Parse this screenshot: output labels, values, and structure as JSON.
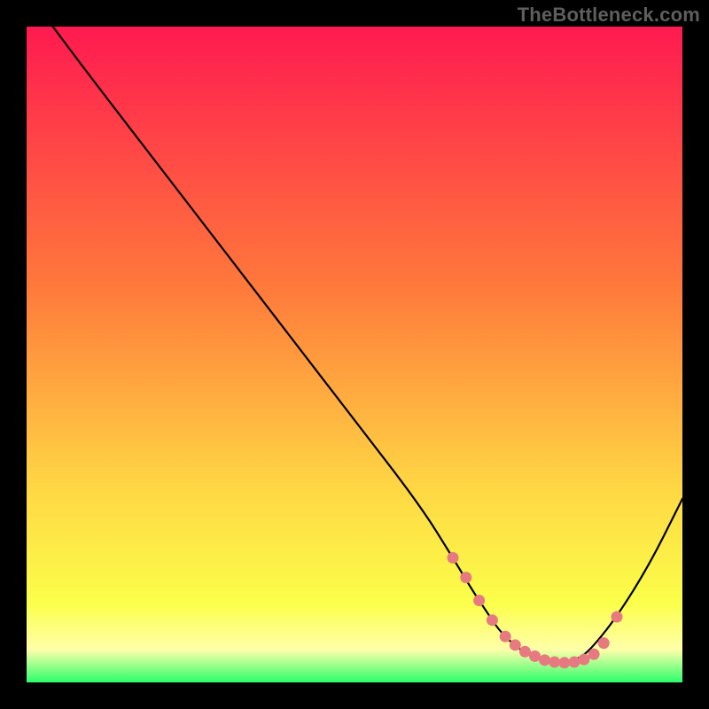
{
  "watermark": "TheBottleneck.com",
  "colors": {
    "page_bg": "#000000",
    "watermark": "#5e5e5e",
    "gradient_top": "#ff1a50",
    "gradient_mid1": "#ff7a3b",
    "gradient_mid2": "#ffd644",
    "gradient_bottom1": "#fbff4a",
    "gradient_bottom2": "#ffffaa",
    "gradient_bottom3": "#2bff6b",
    "curve": "#000000",
    "marker": "#e77a80"
  },
  "chart_data": {
    "type": "line",
    "title": "",
    "xlabel": "",
    "ylabel": "",
    "xlim": [
      0,
      100
    ],
    "ylim": [
      0,
      100
    ],
    "grid": false,
    "legend": false,
    "series": [
      {
        "name": "bottleneck-curve",
        "x": [
          4,
          10,
          20,
          30,
          40,
          50,
          60,
          65,
          68,
          70,
          72,
          74,
          76,
          78,
          80,
          82,
          84,
          86,
          90,
          95,
          100
        ],
        "y": [
          100,
          92,
          79,
          66,
          53,
          40,
          27,
          19,
          14,
          11,
          8,
          6,
          4.5,
          3.5,
          3,
          3,
          3.5,
          5,
          10,
          18,
          28
        ]
      }
    ],
    "markers": {
      "name": "highlight-flat-section",
      "x": [
        65,
        67,
        69,
        71,
        73,
        74.5,
        76,
        77.5,
        79,
        80.5,
        82,
        83.5,
        85,
        86.5,
        88,
        90
      ],
      "y": [
        19,
        16,
        12.5,
        9.5,
        7,
        5.7,
        4.7,
        4,
        3.4,
        3.1,
        3,
        3.1,
        3.5,
        4.3,
        6,
        10
      ]
    }
  }
}
